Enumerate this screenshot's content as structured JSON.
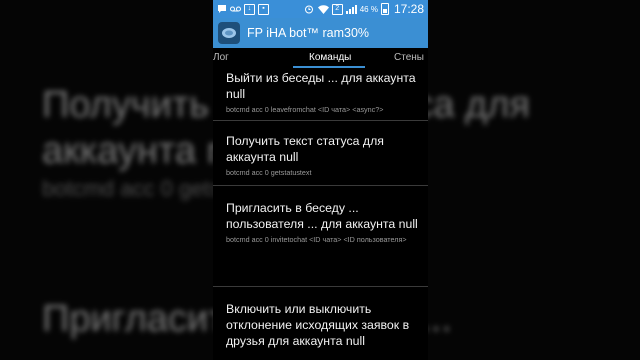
{
  "background": {
    "title_line1": "Получить текст статуса для",
    "title_line2": "аккаунта null",
    "command": "botcmd acc 0 getstatustext",
    "title_line3": "Пригласить в беседу ..."
  },
  "statusbar": {
    "battery_percent": "46 %",
    "time": "17:28",
    "sim_label": "2"
  },
  "appbar": {
    "title": "FP iHA bot™ ram30%"
  },
  "tabs": [
    {
      "label": "Лог"
    },
    {
      "label": "Команды"
    },
    {
      "label": "Стены"
    }
  ],
  "commands": [
    {
      "title": "Выйти из беседы ... для аккаунта null",
      "command": "botcmd acc 0 leavefromchat <ID чата> <async?>"
    },
    {
      "title": "Получить текст статуса для аккаунта null",
      "command": "botcmd acc 0 getstatustext"
    },
    {
      "title": "Пригласить в беседу ... пользователя ... для аккаунта null",
      "command": "botcmd acc 0 invitetochat <ID чата> <ID пользователя>"
    },
    {
      "title": "Включить или выключить отклонение исходящих заявок в друзья для аккаунта null",
      "command": ""
    }
  ],
  "colors": {
    "accent": "#3b8fd3",
    "background": "#000000",
    "divider": "#3a3a3a",
    "secondary_text": "#9a9a9a"
  }
}
